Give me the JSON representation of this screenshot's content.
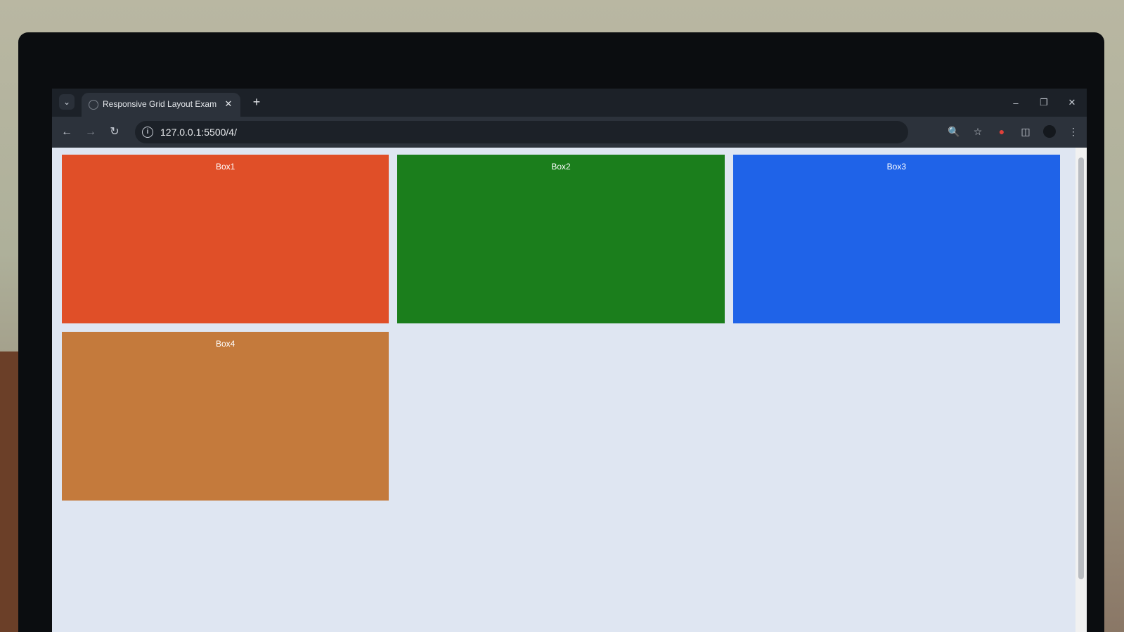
{
  "browser": {
    "tab_title": "Responsive Grid Layout Exampl",
    "new_tab_symbol": "+",
    "url": "127.0.0.1:5500/4/"
  },
  "page": {
    "boxes": [
      {
        "label": "Box1",
        "color": "#e04f28"
      },
      {
        "label": "Box2",
        "color": "#1b7e1c"
      },
      {
        "label": "Box3",
        "color": "#1f63e8"
      },
      {
        "label": "Box4",
        "color": "#c47a3c"
      }
    ]
  },
  "icons": {
    "tab_list": "chevron-down-icon",
    "back": "back-arrow-icon",
    "forward": "forward-arrow-icon",
    "reload": "reload-icon",
    "site_info": "info-icon",
    "zoom": "zoom-icon",
    "bookmark": "star-icon",
    "extension": "extension-icon",
    "puzzle": "puzzle-icon",
    "profile": "avatar",
    "menu": "kebab-menu-icon"
  }
}
